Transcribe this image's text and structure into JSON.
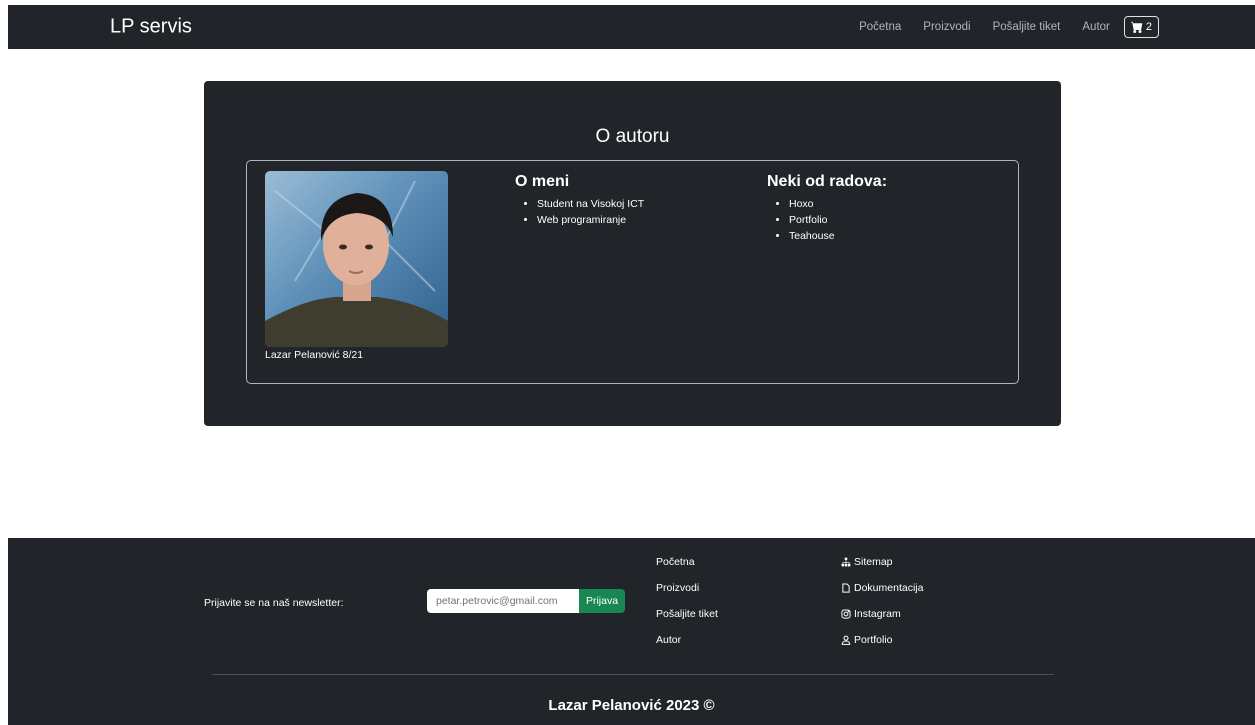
{
  "nav": {
    "brand": "LP servis",
    "links": [
      "Početna",
      "Proizvodi",
      "Pošaljite tiket",
      "Autor"
    ],
    "cart_count": "2"
  },
  "author": {
    "title": "O autoru",
    "caption": "Lazar Pelanović 8/21",
    "about_heading": "O meni",
    "about_items": [
      "Student na Visokoj ICT",
      "Web programiranje"
    ],
    "works_heading": "Neki od radova:",
    "works_items": [
      "Hoxo",
      "Portfolio",
      "Teahouse"
    ]
  },
  "footer": {
    "newsletter_label": "Prijavite se na naš newsletter:",
    "email_value": "petar.petrovic@gmail.com",
    "subscribe_label": "Prijava",
    "links": [
      "Početna",
      "Proizvodi",
      "Pošaljite tiket",
      "Autor"
    ],
    "external": [
      {
        "label": "Sitemap",
        "icon": "sitemap-icon"
      },
      {
        "label": "Dokumentacija",
        "icon": "document-icon"
      },
      {
        "label": "Instagram",
        "icon": "instagram-icon"
      },
      {
        "label": "Portfolio",
        "icon": "person-icon"
      }
    ],
    "copyright": "Lazar Pelanović 2023 ©"
  },
  "colors": {
    "dark": "#212529",
    "muted": "#adb5bd",
    "success": "#198754"
  }
}
